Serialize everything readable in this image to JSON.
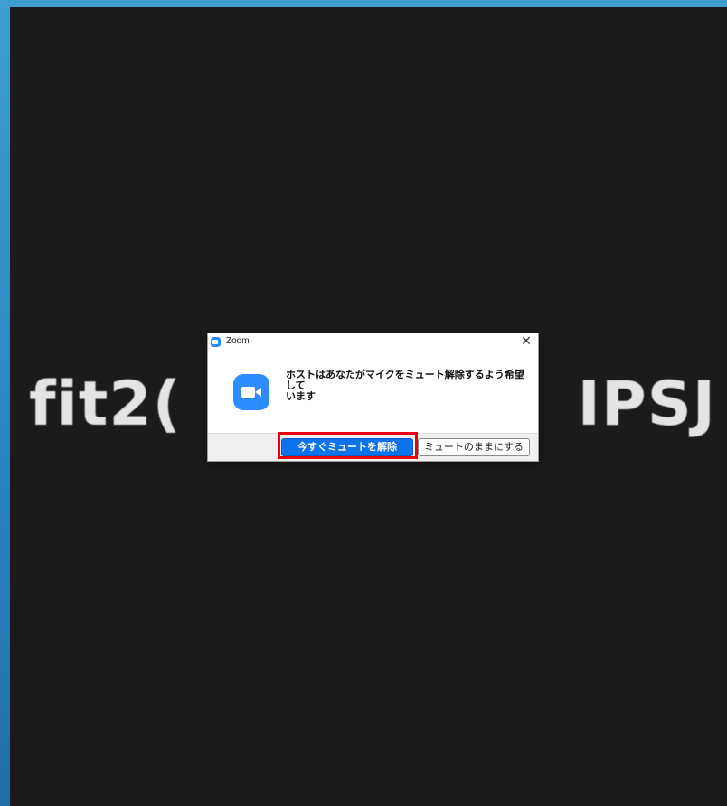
{
  "background": {
    "shared_title_left": "fit2(",
    "shared_title_right": "IPSJ"
  },
  "dialog": {
    "title": "Zoom",
    "close_symbol": "✕",
    "icon": "zoom-camera-icon",
    "message": "ホストはあなたがマイクをミュート解除するよう希望して\nいます",
    "primary_button": "今すぐミュートを解除",
    "secondary_button": "ミュートのままにする",
    "highlight_color": "#e8000b",
    "accent_color": "#2d8cff"
  }
}
